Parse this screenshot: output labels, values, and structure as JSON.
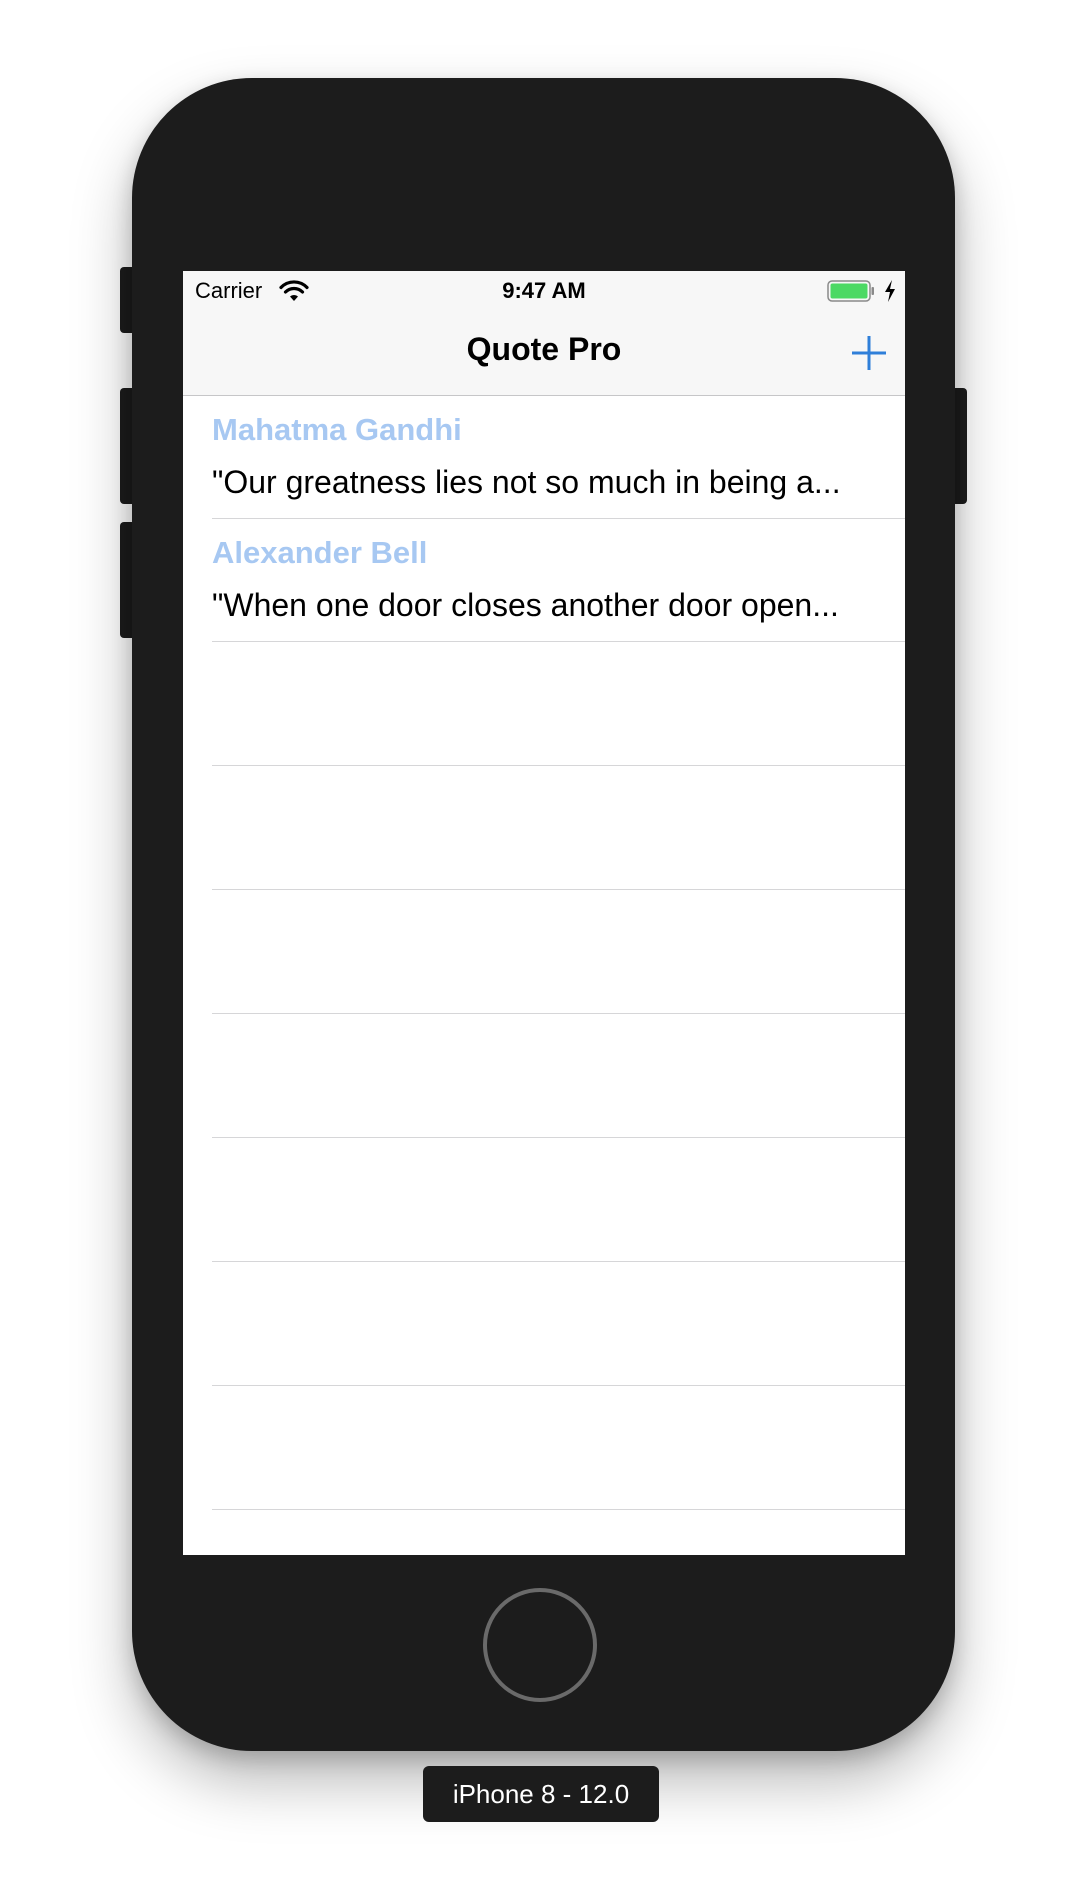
{
  "device": {
    "label": "iPhone 8 - 12.0"
  },
  "status_bar": {
    "carrier": "Carrier",
    "time": "9:47 AM",
    "icons": [
      "wifi-icon",
      "battery-icon",
      "charging-bolt-icon"
    ]
  },
  "nav_bar": {
    "title": "Quote Pro",
    "right_button_icon": "plus-icon"
  },
  "quotes": [
    {
      "author": "Mahatma Gandhi",
      "quote": "\"Our greatness lies not so much in being a..."
    },
    {
      "author": "Alexander Bell",
      "quote": "\"When one door closes another door open..."
    }
  ],
  "colors": {
    "tint": "#2f7fd9",
    "author_text": "#a7c8f2",
    "battery_fill": "#4cd964",
    "device_body": "#1c1c1c"
  }
}
